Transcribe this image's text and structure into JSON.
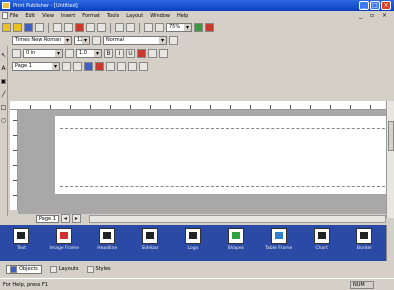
{
  "window": {
    "title": "Print Publisher - [Untitled]",
    "minimize": "_",
    "maximize": "□",
    "close": "×"
  },
  "menu": {
    "items": [
      "File",
      "Edit",
      "View",
      "Insert",
      "Format",
      "Tools",
      "Layout",
      "Window",
      "Help"
    ],
    "mdi": "_ ▫ ×"
  },
  "format": {
    "font": "Times New Roman",
    "size": "12",
    "style": "Normal",
    "zoom": "75%",
    "indent": "0 in",
    "spacing": "1.0"
  },
  "pagenav": {
    "page": "Page 1"
  },
  "gallery": {
    "items": [
      {
        "label": "Text",
        "icon": "text-frame-icon",
        "c": ""
      },
      {
        "label": "Image Frame",
        "icon": "image-frame-icon",
        "c": "c1"
      },
      {
        "label": "Headline",
        "icon": "headline-icon",
        "c": ""
      },
      {
        "label": "Sidebar",
        "icon": "sidebar-icon",
        "c": ""
      },
      {
        "label": "Logo",
        "icon": "logo-icon",
        "c": ""
      },
      {
        "label": "Shapes",
        "icon": "shapes-icon",
        "c": "c3"
      },
      {
        "label": "Table Frame",
        "icon": "table-icon",
        "c": "c2"
      },
      {
        "label": "Chart",
        "icon": "chart-icon",
        "c": ""
      },
      {
        "label": "Border",
        "icon": "border-icon",
        "c": ""
      }
    ]
  },
  "panetabs": [
    {
      "label": "Objects",
      "active": true
    },
    {
      "label": "Layouts",
      "active": false
    },
    {
      "label": "Styles",
      "active": false
    }
  ],
  "status": {
    "left": "For Help, press F1",
    "right": "NUM"
  }
}
